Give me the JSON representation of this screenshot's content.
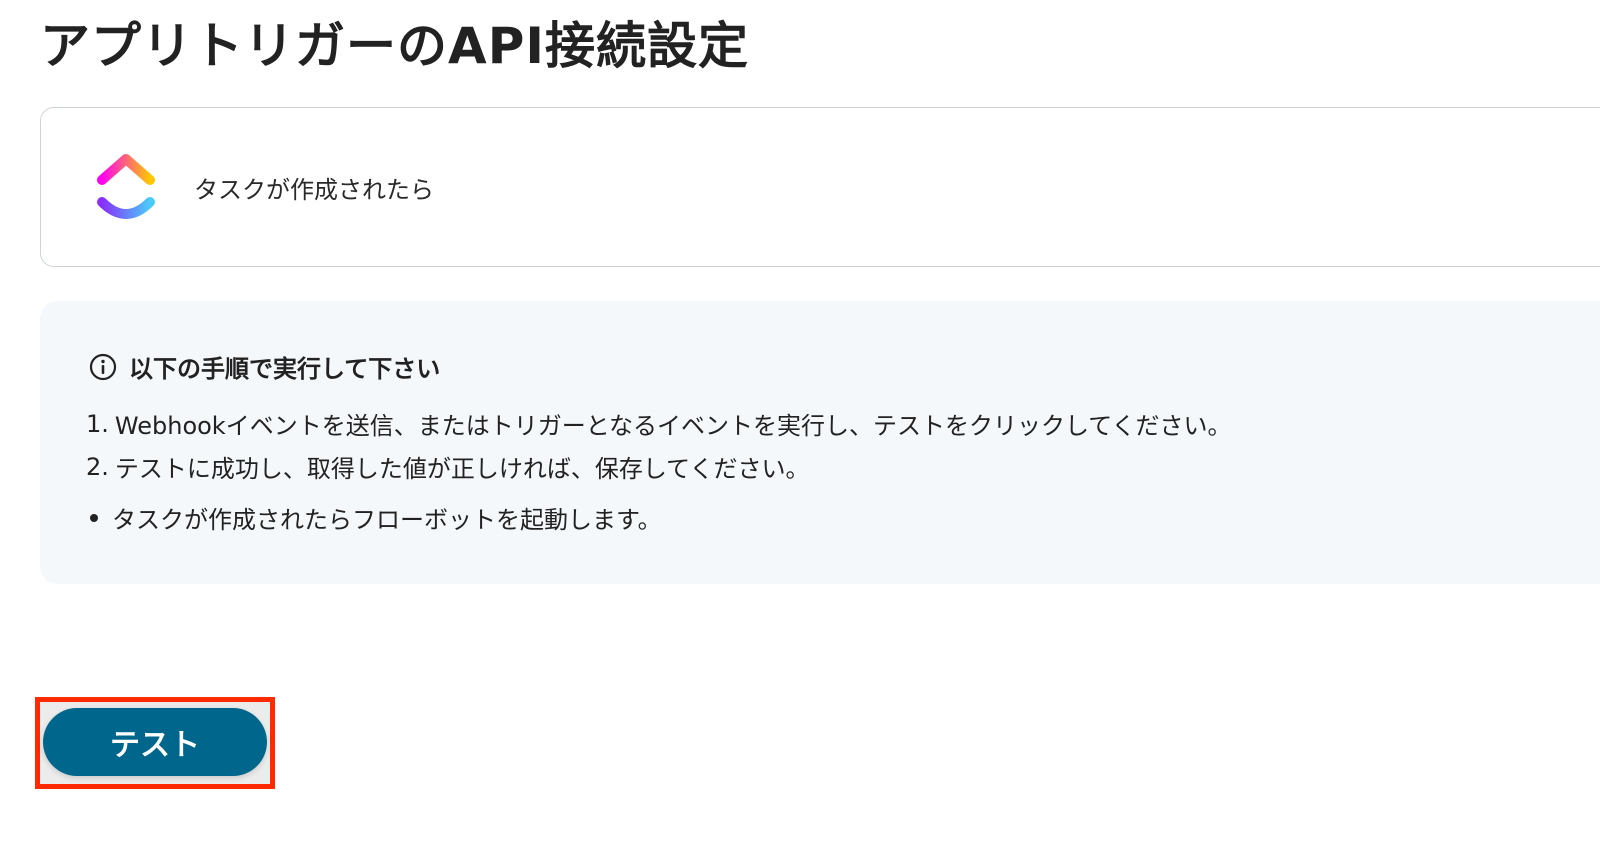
{
  "page": {
    "title": "アプリトリガーのAPI接続設定"
  },
  "trigger_card": {
    "app_icon": "clickup-logo",
    "label": "タスクが作成されたら"
  },
  "instructions": {
    "icon": "info-circle-icon",
    "title": "以下の手順で実行して下さい",
    "steps": [
      {
        "num": "1.",
        "text": "Webhookイベントを送信、またはトリガーとなるイベントを実行し、テストをクリックしてください。"
      },
      {
        "num": "2.",
        "text": "テストに成功し、取得した値が正しければ、保存してください。"
      }
    ],
    "notes": [
      "タスクが作成されたらフローボットを起動します。"
    ]
  },
  "actions": {
    "test_label": "テスト",
    "button_color": "#00668c",
    "highlight_color": "#ff2a00"
  }
}
